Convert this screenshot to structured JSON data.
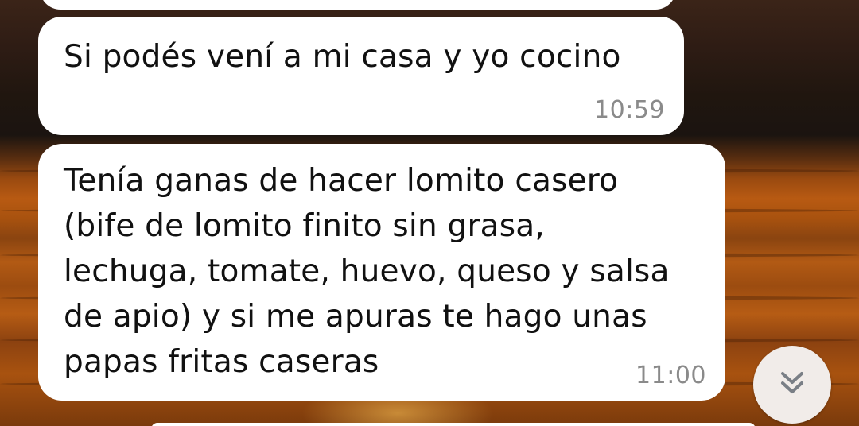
{
  "messages": [
    {
      "text": "Si podés vení a mi casa y yo cocino",
      "time": "10:59"
    },
    {
      "lines": [
        "Tenía ganas de hacer lomito casero",
        "(bife de lomito finito sin grasa,",
        "lechuga, tomate, huevo, queso y salsa",
        "de apio) y si me apuras te hago unas",
        "papas fritas caseras"
      ],
      "time": "11:00"
    }
  ],
  "scroll_button": {
    "icon": "double-chevron-down-icon"
  },
  "colors": {
    "bubble": "#ffffff",
    "text": "#111111",
    "timestamp": "#8a8a8a",
    "scroll_button_bg": "#f1ece9",
    "scroll_icon": "#7a7f86"
  }
}
